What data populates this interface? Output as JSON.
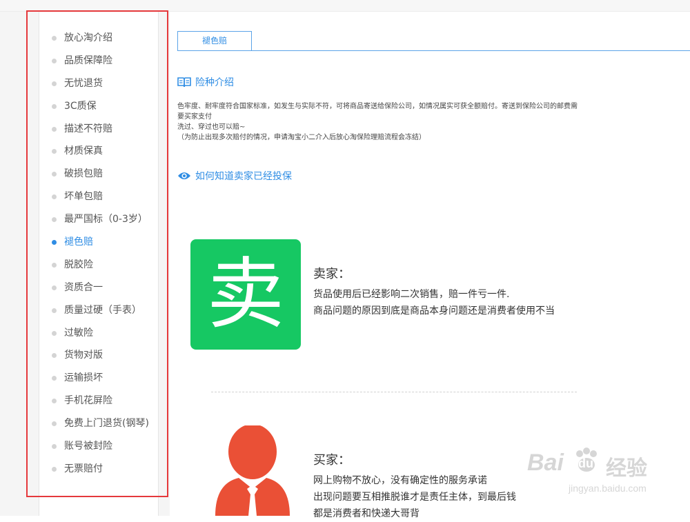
{
  "sidebar": {
    "items": [
      {
        "label": "放心淘介绍",
        "active": false
      },
      {
        "label": "品质保障险",
        "active": false
      },
      {
        "label": "无忧退货",
        "active": false
      },
      {
        "label": "3C质保",
        "active": false
      },
      {
        "label": "描述不符赔",
        "active": false
      },
      {
        "label": "材质保真",
        "active": false
      },
      {
        "label": "破损包赔",
        "active": false
      },
      {
        "label": "坏单包赔",
        "active": false
      },
      {
        "label": "最严国标（0-3岁）",
        "active": false
      },
      {
        "label": "褪色赔",
        "active": true
      },
      {
        "label": "脱胶险",
        "active": false
      },
      {
        "label": "资质合一",
        "active": false
      },
      {
        "label": "质量过硬（手表）",
        "active": false
      },
      {
        "label": "过敏险",
        "active": false
      },
      {
        "label": "货物对版",
        "active": false
      },
      {
        "label": "运输损坏",
        "active": false
      },
      {
        "label": "手机花屏险",
        "active": false
      },
      {
        "label": "免费上门退货(钢琴)",
        "active": false
      },
      {
        "label": "账号被封险",
        "active": false
      },
      {
        "label": "无票赔付",
        "active": false
      }
    ]
  },
  "tabs": {
    "active_label": "褪色赔"
  },
  "intro": {
    "title": "险种介绍",
    "lines": [
      "色牢度、耐牢度符合国家标准，如发生与实际不符，可将商品寄送给保险公司，如情况属实可获全额赔付。寄送到保险公司的邮费需",
      "要买家支付",
      "洗过、穿过也可以赔~",
      "（为防止出现多次赔付的情况，申请淘宝小二介入后放心淘保险理赔流程会冻结）"
    ]
  },
  "howto": {
    "title": "如何知道卖家已经投保"
  },
  "seller": {
    "tile_char": "卖",
    "title": "卖家：",
    "lines": [
      "货品使用后已经影响二次销售，赔一件亏一件.",
      "商品问题的原因到底是商品本身问题还是消费者使用不当"
    ]
  },
  "buyer": {
    "title": "买家：",
    "lines": [
      "网上购物不放心，没有确定性的服务承诺",
      "出现问题要互相推脱谁才是责任主体，到最后钱",
      "都是消费者和快递大哥背"
    ]
  },
  "watermark": {
    "brand": "Bai",
    "brand2": "du",
    "brand3": "经验",
    "url": "jingyan.baidu.com"
  },
  "colors": {
    "accent": "#2f8de4",
    "tile_green": "#16c863",
    "person_red": "#ea5036",
    "highlight": "#e5383b"
  }
}
